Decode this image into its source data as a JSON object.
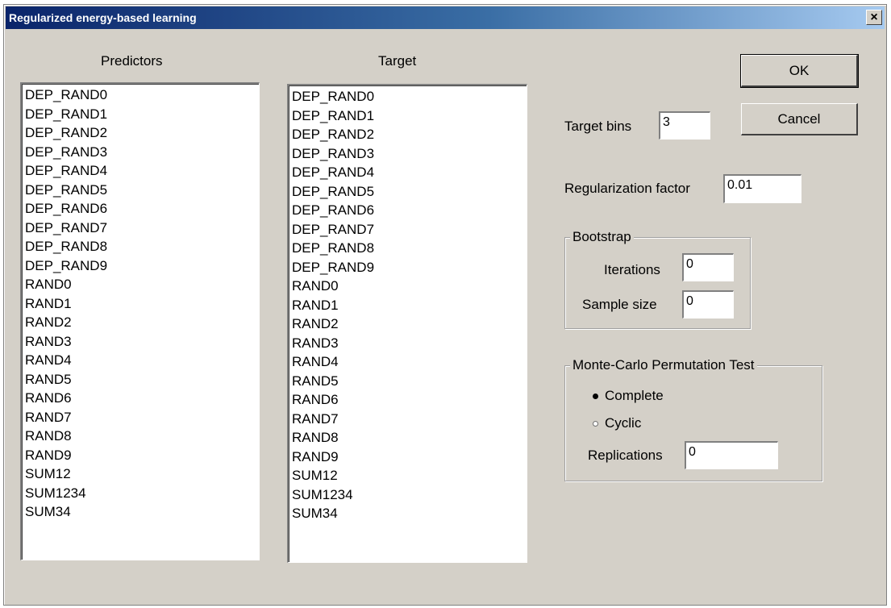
{
  "window": {
    "title": "Regularized energy-based learning",
    "close_label": "×"
  },
  "predictors": {
    "label": "Predictors",
    "items": [
      "DEP_RAND0",
      "DEP_RAND1",
      "DEP_RAND2",
      "DEP_RAND3",
      "DEP_RAND4",
      "DEP_RAND5",
      "DEP_RAND6",
      "DEP_RAND7",
      "DEP_RAND8",
      "DEP_RAND9",
      "RAND0",
      "RAND1",
      "RAND2",
      "RAND3",
      "RAND4",
      "RAND5",
      "RAND6",
      "RAND7",
      "RAND8",
      "RAND9",
      "SUM12",
      "SUM1234",
      "SUM34"
    ]
  },
  "target": {
    "label": "Target",
    "items": [
      "DEP_RAND0",
      "DEP_RAND1",
      "DEP_RAND2",
      "DEP_RAND3",
      "DEP_RAND4",
      "DEP_RAND5",
      "DEP_RAND6",
      "DEP_RAND7",
      "DEP_RAND8",
      "DEP_RAND9",
      "RAND0",
      "RAND1",
      "RAND2",
      "RAND3",
      "RAND4",
      "RAND5",
      "RAND6",
      "RAND7",
      "RAND8",
      "RAND9",
      "SUM12",
      "SUM1234",
      "SUM34"
    ]
  },
  "buttons": {
    "ok": "OK",
    "cancel": "Cancel"
  },
  "target_bins": {
    "label": "Target bins",
    "value": "3"
  },
  "regularization": {
    "label": "Regularization factor",
    "value": "0.01"
  },
  "bootstrap": {
    "legend": "Bootstrap",
    "iterations_label": "Iterations",
    "iterations_value": "0",
    "sample_size_label": "Sample size",
    "sample_size_value": "0"
  },
  "monte_carlo": {
    "legend": "Monte-Carlo Permutation Test",
    "complete_label": "Complete",
    "complete_checked": true,
    "cyclic_label": "Cyclic",
    "cyclic_checked": false,
    "replications_label": "Replications",
    "replications_value": "0"
  }
}
